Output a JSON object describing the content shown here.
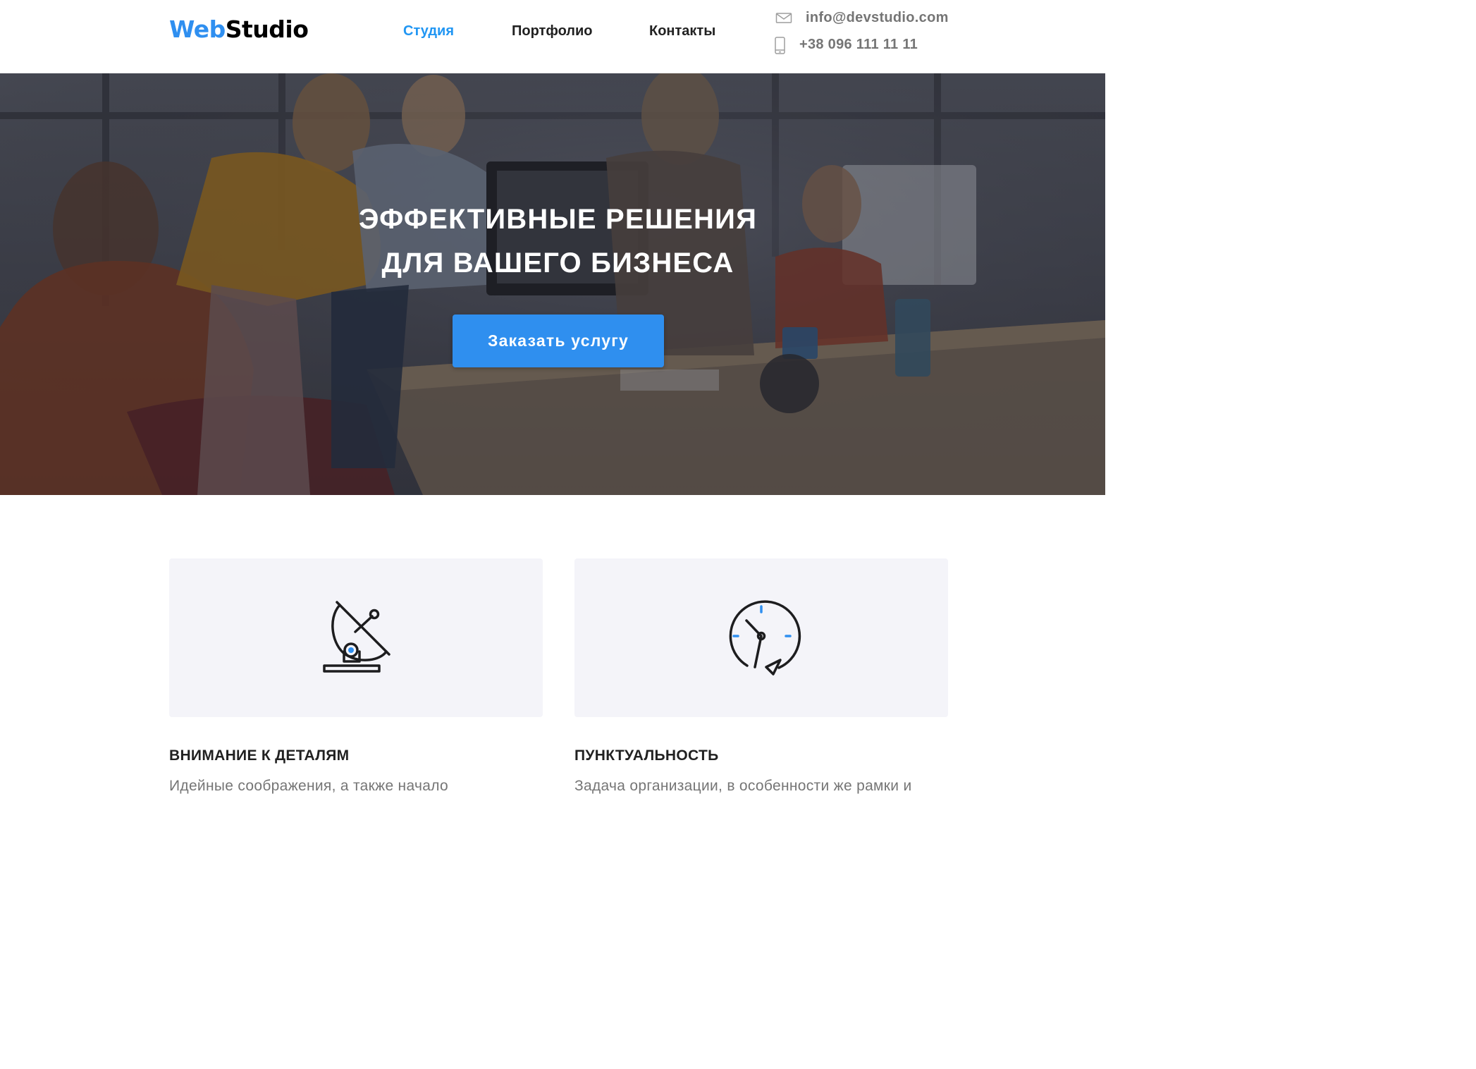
{
  "header": {
    "logo": {
      "part1": "Web",
      "part2": "Studio"
    },
    "nav": [
      {
        "label": "Студия",
        "active": true
      },
      {
        "label": "Портфолио",
        "active": false
      },
      {
        "label": "Контакты",
        "active": false
      }
    ],
    "contacts": {
      "email": "info@devstudio.com",
      "phone": "+38 096 111 11 11",
      "email_icon": "envelope-icon",
      "phone_icon": "smartphone-icon"
    }
  },
  "hero": {
    "title_line1": "ЭФФЕКТИВНЫЕ РЕШЕНИЯ",
    "title_line2": "ДЛЯ ВАШЕГО БИЗНЕСА",
    "button_label": "Заказать услугу",
    "background": "team-office-photo"
  },
  "features": [
    {
      "icon": "satellite-dish-icon",
      "title": "ВНИМАНИЕ К ДЕТАЛЯМ",
      "text": "Идейные соображения, а также начало"
    },
    {
      "icon": "clock-icon",
      "title": "ПУНКТУАЛЬНОСТЬ",
      "text": "Задача организации, в особенности же рамки и"
    }
  ],
  "colors": {
    "accent": "#2f8ff0",
    "nav_active": "#2196f3",
    "card_bg": "#f4f4f9",
    "muted_text": "#757575",
    "hero_overlay": "#2f3038"
  }
}
